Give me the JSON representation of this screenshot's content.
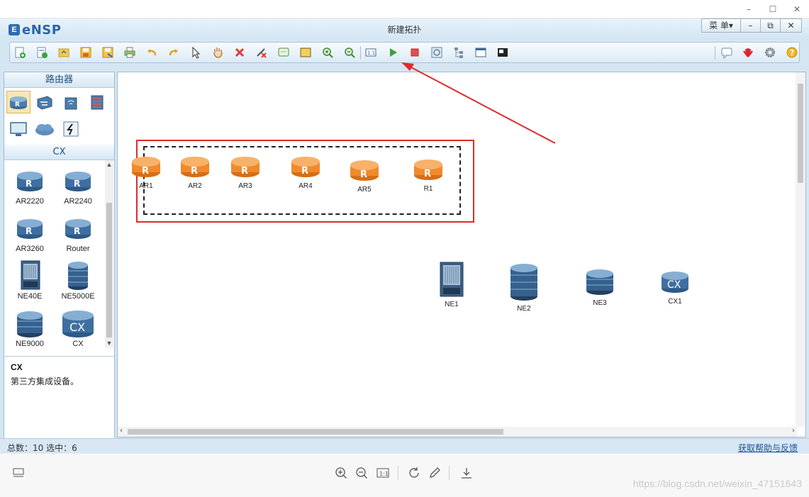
{
  "window": {
    "min": "–",
    "max": "☐",
    "close": "✕"
  },
  "app": {
    "logo_mark": "E",
    "logo_name": "eNSP",
    "title": "新建拓扑",
    "menu_label": "菜 单▾",
    "min": "–",
    "restore": "⧉",
    "close": "✕"
  },
  "toolbar": {
    "items": [
      "new-topology",
      "new-example",
      "open",
      "save",
      "save-as",
      "print",
      "undo",
      "redo",
      "select",
      "pan",
      "delete",
      "delete-link",
      "text",
      "palette",
      "zoom-in",
      "zoom-out",
      "fit",
      "start-device",
      "stop-device",
      "capture",
      "topology-view",
      "grid",
      "console"
    ],
    "right_items": [
      "feedback",
      "huawei",
      "settings",
      "help"
    ],
    "accent_start": "#3aa33a",
    "accent_stop": "#e05050"
  },
  "left_panel": {
    "section1_title": "路由器",
    "section2_title": "CX",
    "categories_top": [
      "router",
      "switch",
      "wireless",
      "firewall"
    ],
    "categories_bottom": [
      "pc",
      "cloud",
      "other"
    ],
    "devices": [
      {
        "name": "AR2220",
        "kind": "router"
      },
      {
        "name": "AR2240",
        "kind": "router"
      },
      {
        "name": "AR3260",
        "kind": "router"
      },
      {
        "name": "Router",
        "kind": "router"
      },
      {
        "name": "NE40E",
        "kind": "chassis"
      },
      {
        "name": "NE5000E",
        "kind": "tower"
      },
      {
        "name": "NE9000",
        "kind": "tower-round"
      },
      {
        "name": "CX",
        "kind": "cx"
      }
    ],
    "desc_title": "CX",
    "desc_text": "第三方集成设备。"
  },
  "canvas": {
    "nodes_selected": [
      {
        "label": "AR1"
      },
      {
        "label": "AR2"
      },
      {
        "label": "AR3"
      },
      {
        "label": "AR4"
      },
      {
        "label": "AR5"
      },
      {
        "label": "R1"
      }
    ],
    "nodes_other": [
      {
        "label": "NE1",
        "kind": "chassis"
      },
      {
        "label": "NE2",
        "kind": "tower"
      },
      {
        "label": "NE3",
        "kind": "tower-round"
      },
      {
        "label": "CX1",
        "kind": "cx"
      }
    ],
    "selected_color": "#f08a2c",
    "annotation_color": "#e02b2b"
  },
  "status": {
    "text": "总数：10  选中：6",
    "help_link": "获取帮助与反馈"
  },
  "viewer": {
    "watermark": "https://blog.csdn.net/weixin_47151643"
  }
}
